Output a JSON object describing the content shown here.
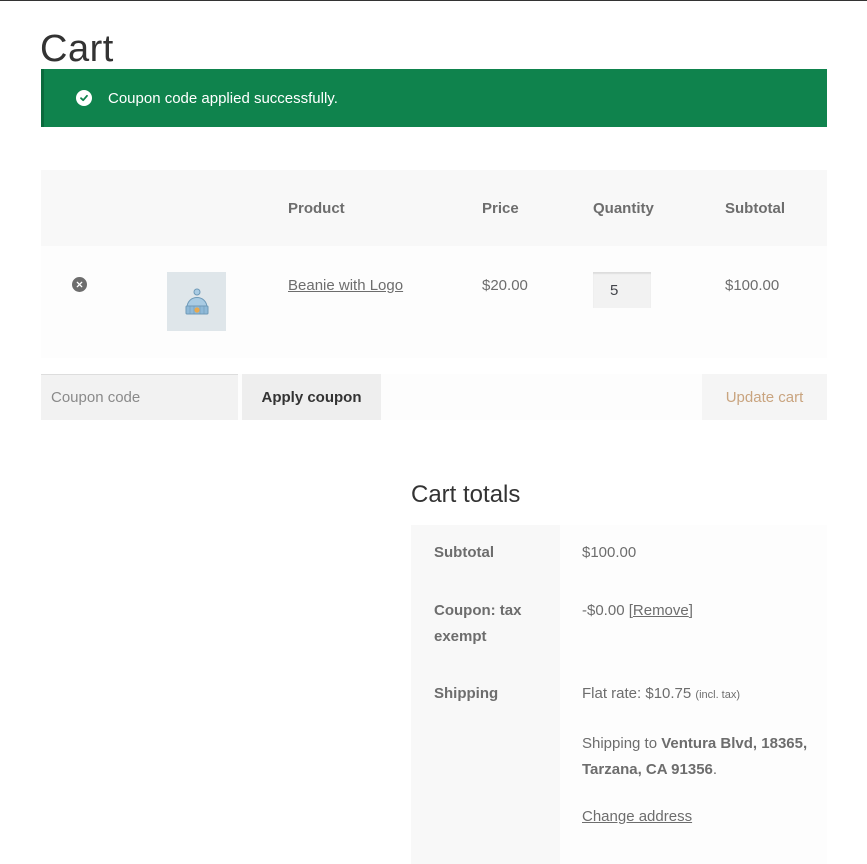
{
  "page": {
    "title": "Cart"
  },
  "notice": {
    "text": "Coupon code applied successfully.",
    "color": "#0f834d",
    "icon": "check-circle-icon"
  },
  "cart_table": {
    "headers": {
      "product": "Product",
      "price": "Price",
      "quantity": "Quantity",
      "subtotal": "Subtotal"
    },
    "items": [
      {
        "name": "Beanie with Logo",
        "price": "$20.00",
        "quantity": "5",
        "subtotal": "$100.00",
        "thumbnail": "beanie-image"
      }
    ]
  },
  "actions": {
    "coupon_placeholder": "Coupon code",
    "apply_label": "Apply coupon",
    "update_label": "Update cart"
  },
  "totals": {
    "title": "Cart totals",
    "subtotal_label": "Subtotal",
    "subtotal_value": "$100.00",
    "coupon_label": "Coupon: tax exempt",
    "coupon_value": "-$0.00",
    "coupon_open": "[",
    "coupon_remove": "Remove",
    "coupon_close": "]",
    "shipping_label": "Shipping",
    "shipping_rate": "Flat rate: $10.75",
    "shipping_tax_note": "(incl. tax)",
    "shipping_to_prefix": "Shipping to",
    "shipping_address": "Ventura Blvd, 18365, Tarzana, CA 91356",
    "shipping_period": ".",
    "change_address": "Change address"
  }
}
